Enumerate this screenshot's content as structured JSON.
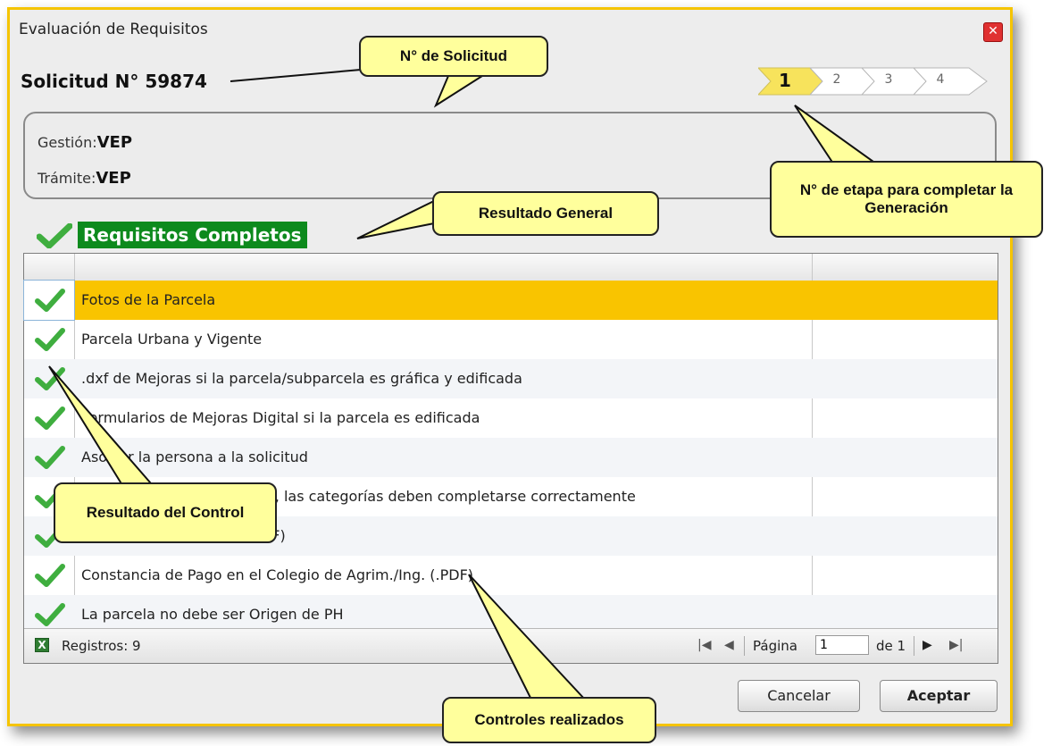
{
  "window": {
    "title": "Evaluación de Requisitos"
  },
  "solicitud_label": "Solicitud N° 59874",
  "steps": [
    "1",
    "2",
    "3",
    "4"
  ],
  "info": {
    "gestion_label": "Gestión:",
    "gestion_value": "VEP",
    "tramite_label": "Trámite:",
    "tramite_value": "VEP"
  },
  "result_general": "Requisitos Completos",
  "grid": {
    "rows": [
      "Fotos de la Parcela",
      "Parcela Urbana y Vigente",
      ".dxf de Mejoras si la parcela/subparcela es gráfica y edificada",
      "Formularios de Mejoras Digital si la parcela es edificada",
      "Asociar la persona a la solicitud",
      "Si las parcelas son gráficas, las categorías deben completarse correctamente",
      "(.PDF)",
      "Constancia de Pago en el Colegio de Agrim./Ing. (.PDF)",
      "La parcela no debe ser Origen de PH"
    ],
    "registros": "Registros: 9",
    "pagina_label": "Página",
    "pagina_value": "1",
    "de_label": "de 1"
  },
  "buttons": {
    "cancel": "Cancelar",
    "accept": "Aceptar"
  },
  "callouts": {
    "solicitud": "N° de Solicitud",
    "etapa": "N° de etapa para completar la Generación",
    "general": "Resultado General",
    "control": "Resultado del Control",
    "controles": "Controles realizados"
  },
  "colors": {
    "accent": "#f9c400",
    "ok_green": "#0d8a1d",
    "callout_bg": "#ffff9c"
  }
}
